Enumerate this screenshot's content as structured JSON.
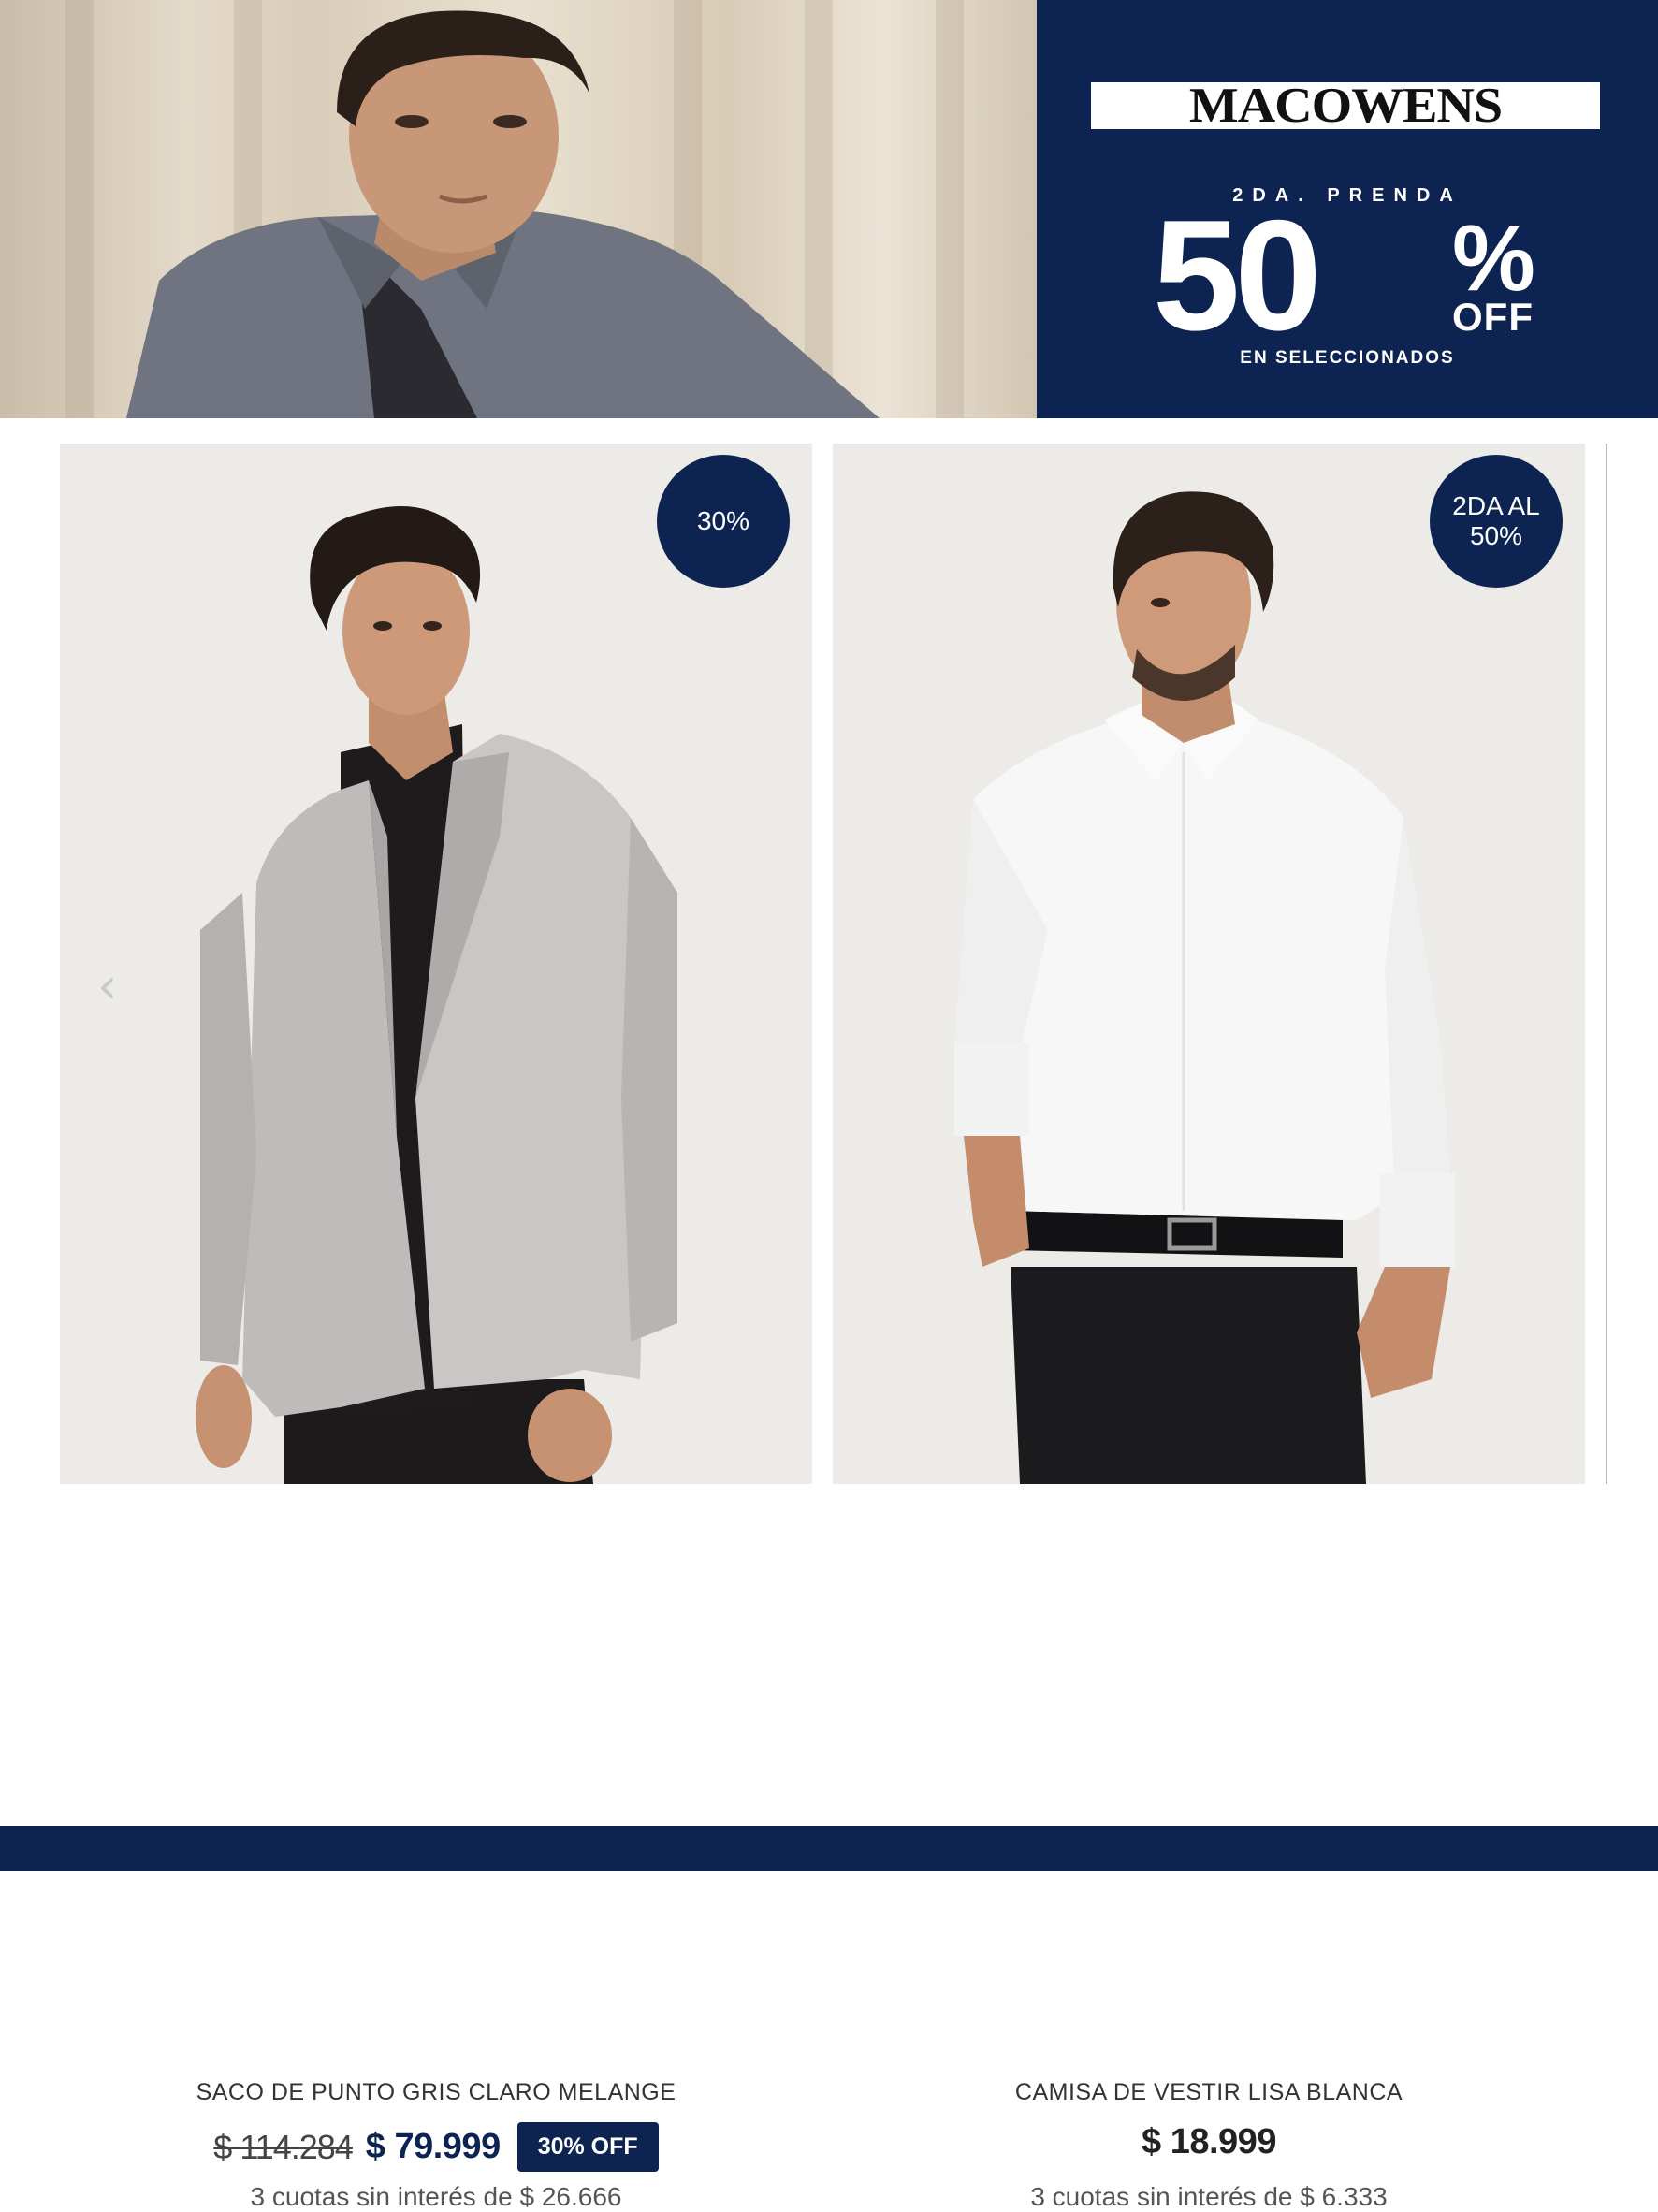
{
  "hero": {
    "brand": "MACOWENS",
    "promo_label": "2DA. PRENDA",
    "promo_number": "50",
    "promo_percent": "%",
    "promo_off": "OFF",
    "promo_sub": "EN SELECCIONADOS",
    "banner_color": "#0d2452"
  },
  "products": [
    {
      "badge": "30%",
      "name": "SACO DE PUNTO GRIS CLARO MELANGE",
      "price_old": "$ 114.284",
      "price_new": "$ 79.999",
      "off_tag": "30% OFF",
      "installments": "3 cuotas sin interés de $ 26.666",
      "carousel_arrow_icon": "chevron-left-icon"
    },
    {
      "badge": "2DA AL\n50%",
      "name": "CAMISA DE VESTIR LISA BLANCA",
      "price": "$ 18.999",
      "installments": "3 cuotas sin interés de $ 6.333"
    }
  ],
  "colors": {
    "navy": "#0d2452",
    "text": "#333333"
  }
}
